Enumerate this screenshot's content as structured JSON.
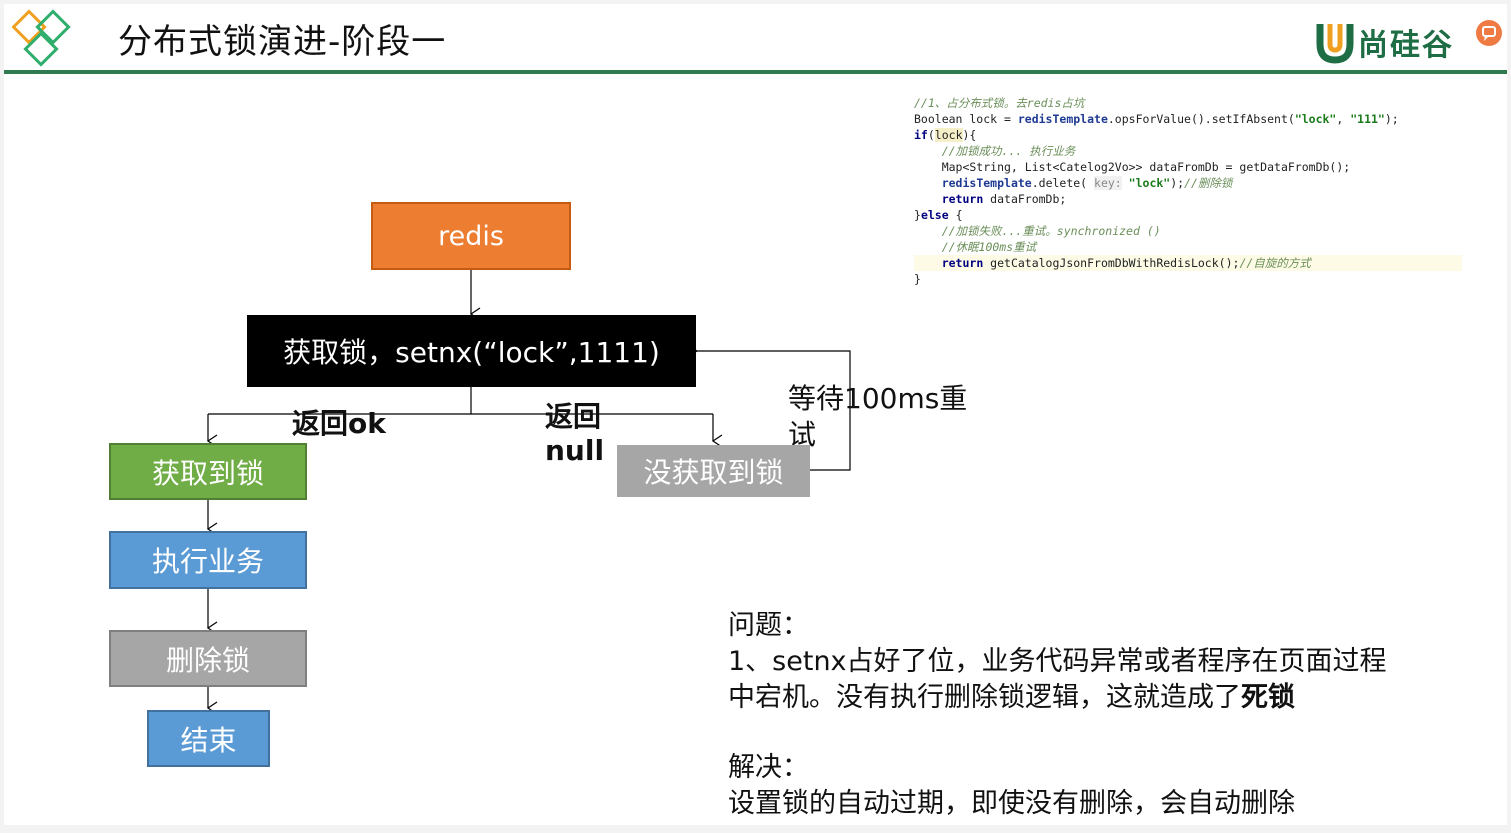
{
  "header": {
    "title": "分布式锁演进-阶段一",
    "brand_logo_text": "尚硅谷"
  },
  "flow": {
    "redis": "redis",
    "acquire": "获取锁，setnx(“lock”,1111)",
    "return_ok": "返回ok",
    "return_null_1": "返回",
    "return_null_2": "null",
    "got_lock": "获取到锁",
    "no_lock": "没获取到锁",
    "retry_1": "等待100ms重",
    "retry_2": "试",
    "execute": "执行业务",
    "delete": "删除锁",
    "end": "结束"
  },
  "colors": {
    "redis": "#ed7d31",
    "acquire": "#000000",
    "got_lock": "#70ad47",
    "blue": "#5b9bd5",
    "gray": "#a6a6a6",
    "header_line": "#2f7a50"
  },
  "code": {
    "l1": "//1、占分布式锁。去redis占坑",
    "l2a": "Boolean lock = ",
    "l2b": "redisTemplate",
    "l2c": ".opsForValue().setIfAbsent(",
    "l2d": "\"lock\"",
    "l2e": ", ",
    "l2f": "\"111\"",
    "l2g": ");",
    "l3a": "if",
    "l3b": "(",
    "l3c": "lock",
    "l3d": "){",
    "l4": "    //加锁成功... 执行业务",
    "l5": "    Map<String, List<Catelog2Vo>> dataFromDb = getDataFromDb();",
    "l6a": "    ",
    "l6b": "redisTemplate",
    "l6c": ".delete( ",
    "l6d": "key:",
    "l6e": " ",
    "l6f": "\"lock\"",
    "l6g": ");",
    "l6h": "//删除锁",
    "l7a": "    ",
    "l7b": "return",
    "l7c": " dataFromDb;",
    "l8a": "}",
    "l8b": "else",
    "l8c": " {",
    "l9": "    //加锁失败...重试。synchronized ()",
    "l10": "    //休眠100ms重试",
    "l11a": "    ",
    "l11b": "return",
    "l11c": " getCatalogJsonFromDbWithRedisLock();",
    "l11d": "//自旋的方式",
    "l12": "}"
  },
  "notes": {
    "problem_heading": "问题：",
    "problem_line1": "1、setnx占好了位，业务代码异常或者程序在页面过程",
    "problem_line2": "中宕机。没有执行删除锁逻辑，这就造成了",
    "problem_emphasis": "死锁",
    "solution_heading": "解决：",
    "solution_line": "设置锁的自动过期，即使没有删除，会自动删除"
  }
}
